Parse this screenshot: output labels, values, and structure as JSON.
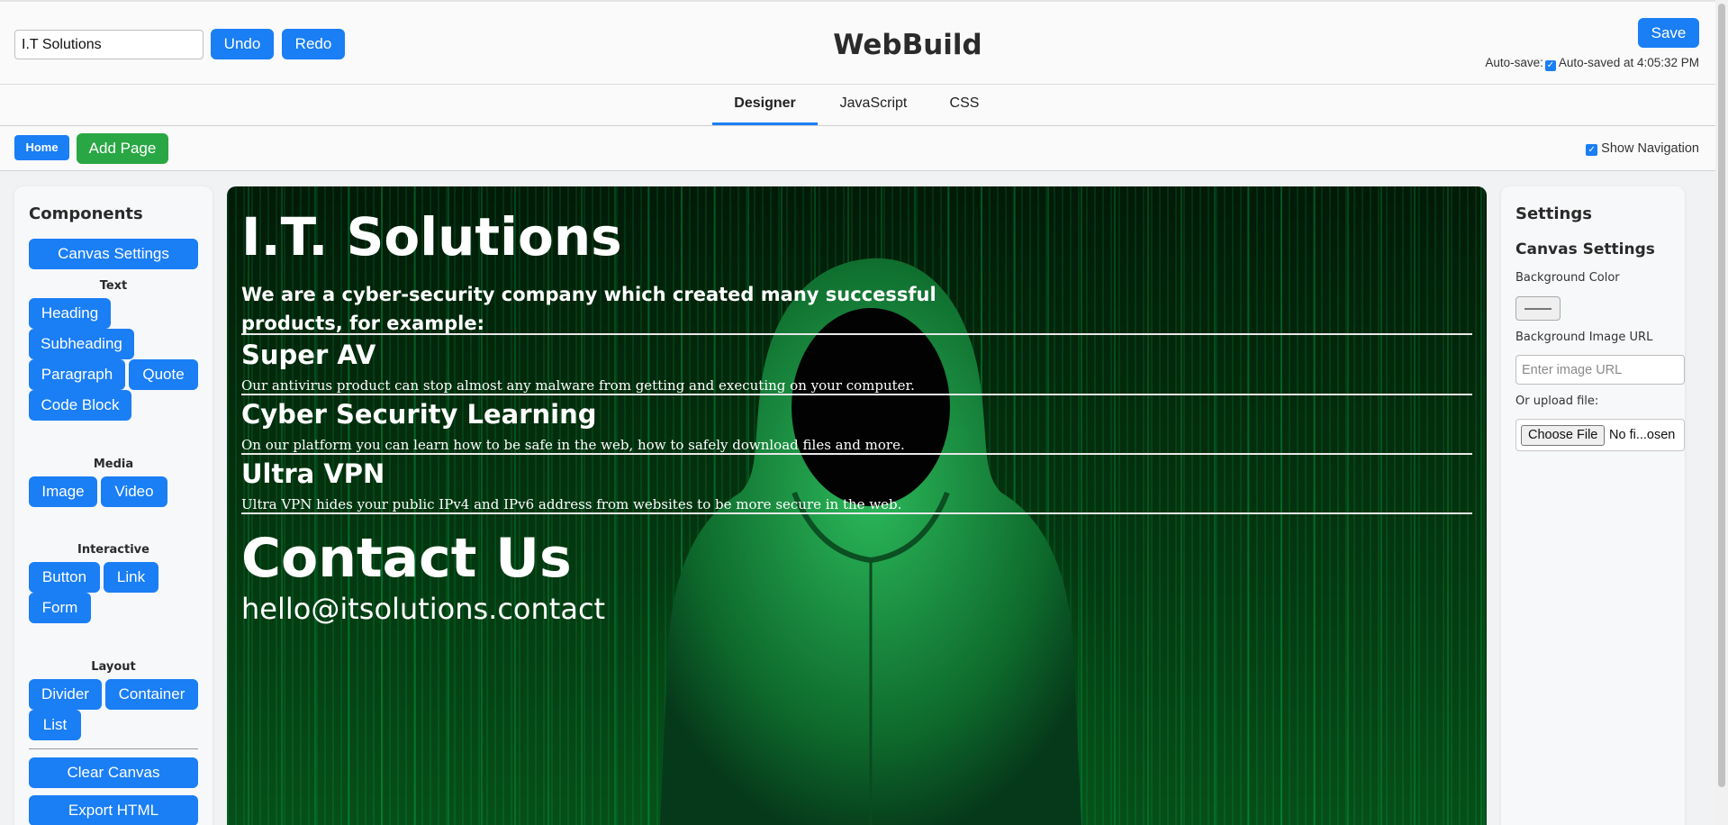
{
  "header": {
    "site_name_value": "I.T Solutions",
    "undo_label": "Undo",
    "redo_label": "Redo",
    "app_title": "WebBuild",
    "save_label": "Save",
    "autosave_label": "Auto-save:",
    "autosave_checked": true,
    "autosave_status": "Auto-saved at 4:05:32 PM"
  },
  "tabs": [
    {
      "label": "Designer",
      "active": true
    },
    {
      "label": "JavaScript",
      "active": false
    },
    {
      "label": "CSS",
      "active": false
    }
  ],
  "pages": {
    "home_label": "Home",
    "add_page_label": "Add Page",
    "show_navigation_label": "Show Navigation",
    "show_navigation_checked": true
  },
  "components": {
    "title": "Components",
    "canvas_settings": "Canvas Settings",
    "text_section": "Text",
    "text_items": [
      "Heading",
      "Subheading",
      "Paragraph",
      "Quote",
      "Code Block"
    ],
    "media_section": "Media",
    "media_items": [
      "Image",
      "Video"
    ],
    "interactive_section": "Interactive",
    "interactive_items": [
      "Button",
      "Link",
      "Form"
    ],
    "layout_section": "Layout",
    "layout_items": [
      "Divider",
      "Container",
      "List"
    ],
    "clear_canvas": "Clear Canvas",
    "export_html": "Export HTML"
  },
  "canvas": {
    "title": "I.T. Solutions",
    "intro": "We are a cyber-security company which created many successful products, for example:",
    "products": [
      {
        "name": "Super AV",
        "desc": "Our antivirus product can stop almost any malware from getting and executing on your computer."
      },
      {
        "name": "Cyber Security Learning",
        "desc": "On our platform you can learn how to be safe in the web, how to safely download files and more."
      },
      {
        "name": "Ultra VPN",
        "desc": "Ultra VPN hides your public IPv4 and IPv6 address from websites to be more secure in the web."
      }
    ],
    "contact_heading": "Contact Us",
    "contact_email": "hello@itsolutions.contact"
  },
  "settings": {
    "title": "Settings",
    "subtitle": "Canvas Settings",
    "bg_color_label": "Background Color",
    "bg_image_label": "Background Image URL",
    "bg_image_placeholder": "Enter image URL",
    "upload_label": "Or upload file:",
    "choose_file_label": "Choose File",
    "file_status": "No fi...osen"
  },
  "colors": {
    "accent": "#1a7ef5",
    "success": "#29a745"
  }
}
